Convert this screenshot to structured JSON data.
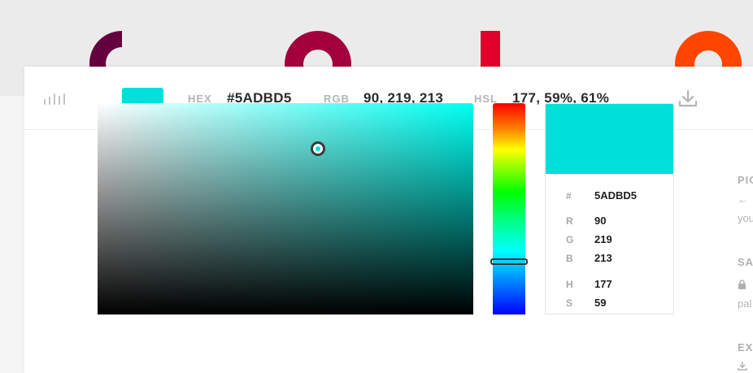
{
  "colors": {
    "current": "#00e0d8",
    "deco": [
      "#63003f",
      "#a1003c",
      "#e0002b",
      "#ff4500",
      "#c9f59c"
    ]
  },
  "toolbar": {
    "hex_label": "HEX",
    "hex_value": "#5ADBD5",
    "rgb_label": "RGB",
    "rgb_value": "90, 219, 213",
    "hsl_label": "HSL",
    "hsl_value": "177, 59%, 61%",
    "icons": [
      "bars-icon",
      "download-icon"
    ]
  },
  "preview": {
    "rows": [
      {
        "label": "#",
        "value": "5ADBD5"
      },
      {
        "label": "R",
        "value": "90"
      },
      {
        "label": "G",
        "value": "219"
      },
      {
        "label": "B",
        "value": "213"
      },
      {
        "label": "H",
        "value": "177"
      },
      {
        "label": "S",
        "value": "59"
      }
    ]
  },
  "picker": {
    "hue": 177,
    "saturation": 59,
    "lightness": 61
  },
  "sidebar": {
    "pick_heading": "PIC",
    "pick_arrow": "←",
    "pick_text": "you",
    "save_heading": "SA",
    "save_text": "pal",
    "export_heading": "EX"
  }
}
